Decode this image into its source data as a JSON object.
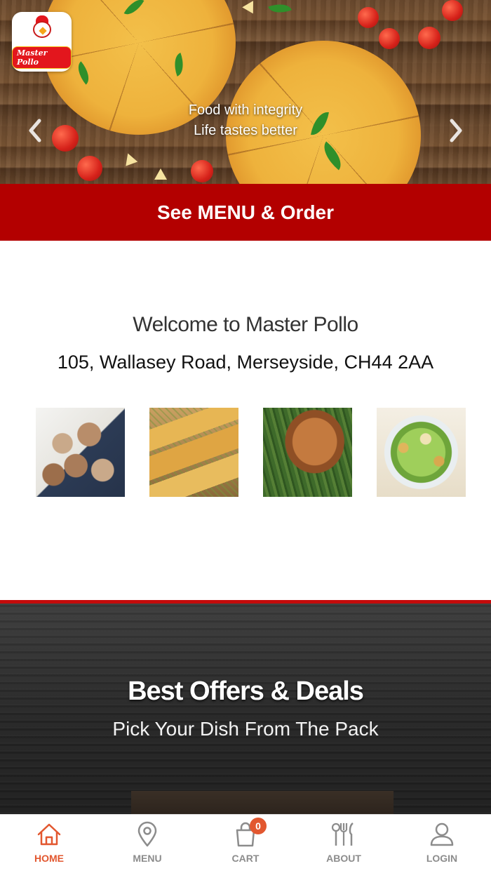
{
  "hero": {
    "logo_text": "Master Pollo",
    "caption_line1": "Food with integrity",
    "caption_line2": "Life tastes better",
    "prev_icon": "chevron-left-icon",
    "next_icon": "chevron-right-icon"
  },
  "order_button": {
    "label": "See MENU & Order",
    "color": "#b30000"
  },
  "welcome": {
    "title": "Welcome to Master Pollo",
    "address": "105, Wallasey Road, Merseyside, CH44 2AA",
    "thumbnails": [
      "mushrooms",
      "garlic-bread",
      "grilled-salmon",
      "caesar-salad"
    ]
  },
  "offers": {
    "title": "Best Offers & Deals",
    "subtitle": "Pick Your Dish From The Pack",
    "border_color": "#c40b0b"
  },
  "bottom_nav": {
    "active_color": "#e2572f",
    "items": [
      {
        "label": "HOME",
        "icon": "home-icon",
        "active": true
      },
      {
        "label": "MENU",
        "icon": "location-pin-icon",
        "active": false
      },
      {
        "label": "CART",
        "icon": "shopping-bag-icon",
        "active": false,
        "badge": "0"
      },
      {
        "label": "ABOUT",
        "icon": "utensils-icon",
        "active": false
      },
      {
        "label": "LOGIN",
        "icon": "user-icon",
        "active": false
      }
    ]
  }
}
